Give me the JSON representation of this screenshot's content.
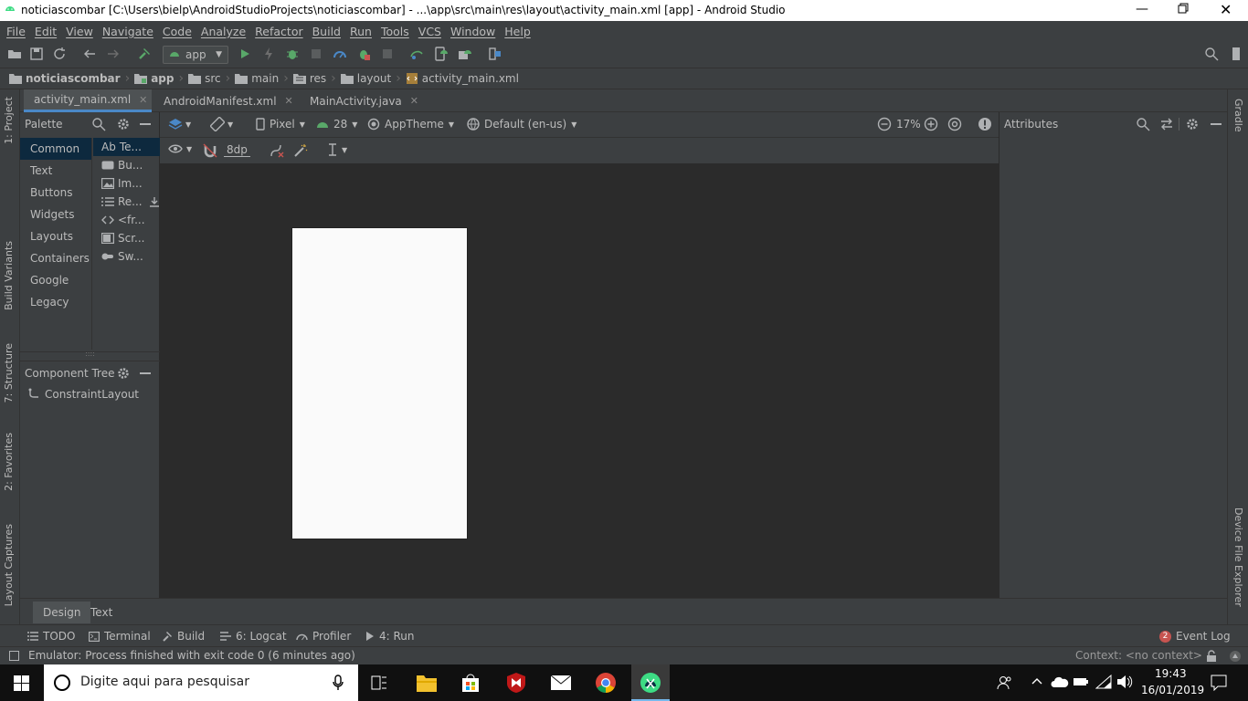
{
  "window": {
    "title": "noticiascombar [C:\\Users\\bielp\\AndroidStudioProjects\\noticiascombar] - ...\\app\\src\\main\\res\\layout\\activity_main.xml [app] - Android Studio"
  },
  "menu": [
    "File",
    "Edit",
    "View",
    "Navigate",
    "Code",
    "Analyze",
    "Refactor",
    "Build",
    "Run",
    "Tools",
    "VCS",
    "Window",
    "Help"
  ],
  "toolbar": {
    "run_config": "app"
  },
  "breadcrumbs": [
    "noticiascombar",
    "app",
    "src",
    "main",
    "res",
    "layout",
    "activity_main.xml"
  ],
  "editor_tabs": [
    {
      "label": "activity_main.xml"
    },
    {
      "label": "AndroidManifest.xml"
    },
    {
      "label": "MainActivity.java"
    }
  ],
  "left_strip": {
    "project": "1: Project",
    "build_variants": "Build Variants",
    "structure": "7: Structure",
    "favorites": "2: Favorites",
    "captures": "Layout Captures"
  },
  "right_strip": {
    "gradle": "Gradle",
    "device_explorer": "Device File Explorer"
  },
  "palette": {
    "title": "Palette",
    "categories": [
      "Common",
      "Text",
      "Buttons",
      "Widgets",
      "Layouts",
      "Containers",
      "Google",
      "Legacy"
    ],
    "selected_category": "Common",
    "items": [
      {
        "prefix": "Ab",
        "label": "Te..."
      },
      {
        "label": "Bu..."
      },
      {
        "label": "Im..."
      },
      {
        "label": "Re..."
      },
      {
        "label": "<fr..."
      },
      {
        "label": "Scr..."
      },
      {
        "label": "Sw..."
      }
    ]
  },
  "component_tree": {
    "title": "Component Tree",
    "root": "ConstraintLayout"
  },
  "design_toolbar": {
    "device": "Pixel",
    "api": "28",
    "theme": "AppTheme",
    "locale": "Default (en-us)",
    "zoom": "17%",
    "margin": "8dp"
  },
  "attributes": {
    "title": "Attributes"
  },
  "design_tabs": [
    "Design",
    "Text"
  ],
  "tool_windows": [
    {
      "label": "TODO"
    },
    {
      "label": "Terminal"
    },
    {
      "label": "Build"
    },
    {
      "label": "6: Logcat"
    },
    {
      "label": "Profiler"
    },
    {
      "label": "4: Run"
    }
  ],
  "event_log": {
    "count": "2",
    "label": "Event Log"
  },
  "status": {
    "message": "Emulator: Process finished with exit code 0 (6 minutes ago)",
    "context": "Context: <no context>"
  },
  "taskbar": {
    "search_placeholder": "Digite aqui para pesquisar",
    "time": "19:43",
    "date": "16/01/2019"
  },
  "colors": {
    "accent": "#4a88c7",
    "selection": "#0d293e",
    "run_green": "#59a869",
    "error_red": "#c75450"
  }
}
